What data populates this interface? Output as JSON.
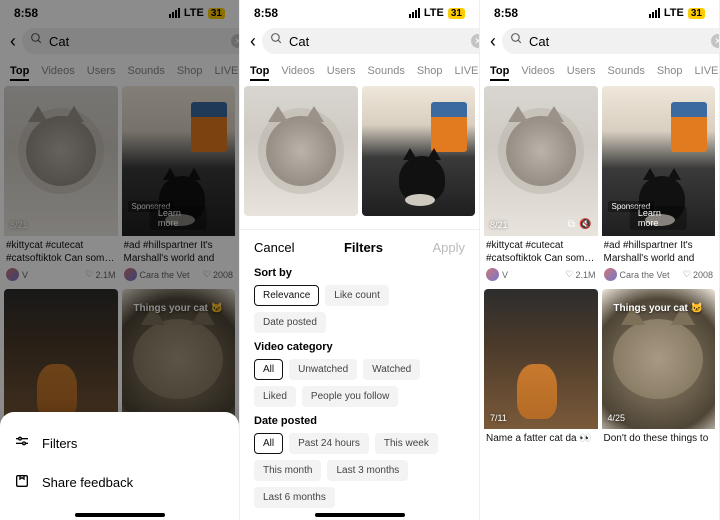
{
  "status": {
    "time": "8:58",
    "carrier": "LTE",
    "battery": "31"
  },
  "search": {
    "query": "Cat"
  },
  "tabs": [
    "Top",
    "Videos",
    "Users",
    "Sounds",
    "Shop",
    "LIVE"
  ],
  "cards": {
    "c1": {
      "date": "8/21",
      "caption": "#kittycat #cutecat #catsoftiktok Can som…",
      "user": "V",
      "likes": "2.1M"
    },
    "c2": {
      "sponsored": "Sponsored",
      "learn": "Learn more",
      "caption": "#ad #hillspartner It's Marshall's world and we…",
      "user": "Cara the Vet",
      "likes": "2008"
    },
    "c3": {
      "date": "7/11",
      "overlay": "",
      "caption": "Name a fatter cat da 👀"
    },
    "c4": {
      "date": "4/25",
      "overlay": "Things your cat 🐱",
      "caption": "Don't do these things to"
    }
  },
  "bottom_sheet": {
    "filters": "Filters",
    "feedback": "Share feedback"
  },
  "filters_panel": {
    "cancel": "Cancel",
    "title": "Filters",
    "apply": "Apply",
    "sort_title": "Sort by",
    "sort": [
      "Relevance",
      "Like count",
      "Date posted"
    ],
    "cat_title": "Video category",
    "cat": [
      "All",
      "Unwatched",
      "Watched",
      "Liked",
      "People you follow"
    ],
    "date_title": "Date posted",
    "date": [
      "All",
      "Past 24 hours",
      "This week",
      "This month",
      "Last 3 months",
      "Last 6 months"
    ]
  }
}
